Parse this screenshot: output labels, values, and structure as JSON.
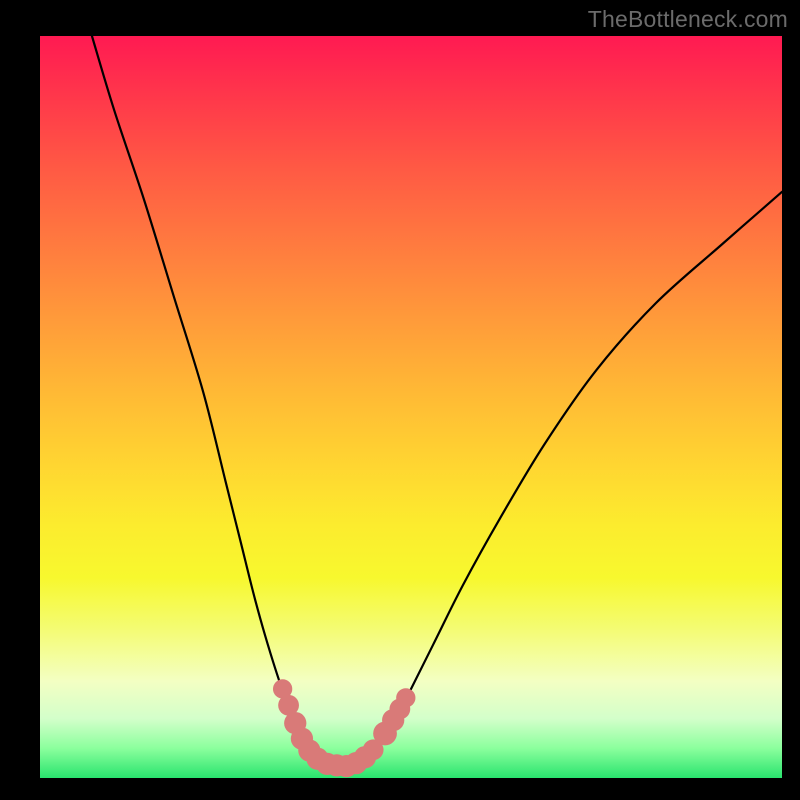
{
  "watermark": "TheBottleneck.com",
  "colors": {
    "background": "#000000",
    "curve": "#000000",
    "markers": "#d97a78",
    "gradient_top": "#ff1a52",
    "gradient_bottom": "#29e46e"
  },
  "chart_data": {
    "type": "line",
    "title": "",
    "xlabel": "",
    "ylabel": "",
    "xlim": [
      0,
      100
    ],
    "ylim": [
      0,
      100
    ],
    "grid": false,
    "legend": false,
    "annotations": [
      "TheBottleneck.com"
    ],
    "series": [
      {
        "name": "bottleneck-curve",
        "x": [
          7,
          10,
          14,
          18,
          22,
          25,
          27,
          29,
          31,
          33,
          35,
          36,
          37,
          38,
          39,
          40,
          41,
          42,
          43,
          44,
          45,
          46,
          48,
          50,
          53,
          57,
          62,
          68,
          75,
          83,
          92,
          100
        ],
        "y": [
          100,
          90,
          78,
          65,
          52,
          40,
          32,
          24,
          17,
          11,
          7,
          5,
          3.5,
          2.5,
          2,
          1.7,
          1.5,
          1.6,
          2,
          2.6,
          3.5,
          5,
          8,
          12,
          18,
          26,
          35,
          45,
          55,
          64,
          72,
          79
        ]
      }
    ],
    "markers": [
      {
        "x": 32.7,
        "y": 12.0,
        "r": 1.3
      },
      {
        "x": 33.5,
        "y": 9.8,
        "r": 1.4
      },
      {
        "x": 34.4,
        "y": 7.4,
        "r": 1.5
      },
      {
        "x": 35.3,
        "y": 5.3,
        "r": 1.5
      },
      {
        "x": 36.3,
        "y": 3.7,
        "r": 1.5
      },
      {
        "x": 37.4,
        "y": 2.6,
        "r": 1.5
      },
      {
        "x": 38.7,
        "y": 1.9,
        "r": 1.5
      },
      {
        "x": 40.0,
        "y": 1.7,
        "r": 1.5
      },
      {
        "x": 41.3,
        "y": 1.6,
        "r": 1.5
      },
      {
        "x": 42.6,
        "y": 2.0,
        "r": 1.5
      },
      {
        "x": 43.8,
        "y": 2.8,
        "r": 1.5
      },
      {
        "x": 44.9,
        "y": 3.8,
        "r": 1.4
      },
      {
        "x": 46.5,
        "y": 6.0,
        "r": 1.6
      },
      {
        "x": 47.6,
        "y": 7.8,
        "r": 1.5
      },
      {
        "x": 48.5,
        "y": 9.3,
        "r": 1.4
      },
      {
        "x": 49.3,
        "y": 10.8,
        "r": 1.3
      }
    ]
  }
}
